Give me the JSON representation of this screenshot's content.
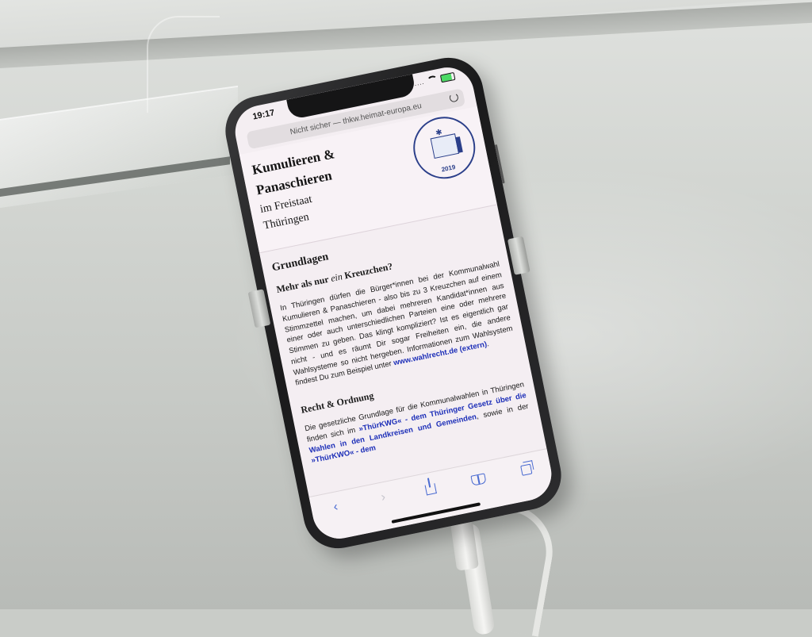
{
  "status": {
    "time": "19:17",
    "signal": "....",
    "battery": "full"
  },
  "browser": {
    "url": "Nicht sicher — thkw.heimat-europa.eu"
  },
  "hero": {
    "title_line1": "Kumulieren &",
    "title_line2": "Panaschieren",
    "title_line3": "im Freistaat",
    "title_line4": "Thüringen",
    "seal_text": "ERSTWÄHLERINNEN KAMPAGNE KOMMUNAL- UND EUROPAWAHL",
    "seal_label": "HEIMAT EUROPA",
    "seal_year": "2019"
  },
  "content": {
    "h2_grundlagen": "Grundlagen",
    "h3_kreuzchen_pre": "Mehr als nur ",
    "h3_kreuzchen_em": "ein",
    "h3_kreuzchen_post": " Kreuzchen?",
    "para1": "In Thüringen dürfen die Bürger*innen bei der Kommunalwahl Kumulieren & Panaschieren - also bis zu 3 Kreuzchen auf einem Stimmzettel machen, um dabei mehreren Kandidat*innen aus einer oder auch unterschiedlichen Parteien eine oder mehrere Stimmen zu geben. Das klingt kompliziert? Ist es eigentlich gar nicht - und es räumt Dir sogar Freiheiten ein, die andere Wahlsysteme so nicht hergeben. Informationen zum Wahlsystem findest Du zum Beispiel unter ",
    "para1_link": "www.wahlrecht.de (extern)",
    "para1_end": ".",
    "h3_recht": "Recht & Ordnung",
    "para2_a": "Die gesetzliche Grundlage für die Kommunalwahlen in Thüringen finden sich im ",
    "para2_link1": "»ThürKWG« - dem Thüringer Gesetz über die Wahlen in den Landkreisen und Gemeinden",
    "para2_b": ", sowie in der ",
    "para2_link2": "»ThürKWO« - dem"
  },
  "toolbar": {
    "back": "‹",
    "forward": "›"
  },
  "colors": {
    "link": "#1d2fb8",
    "seal": "#2b3f8a",
    "toolbar_accent": "#4a6bd1"
  }
}
